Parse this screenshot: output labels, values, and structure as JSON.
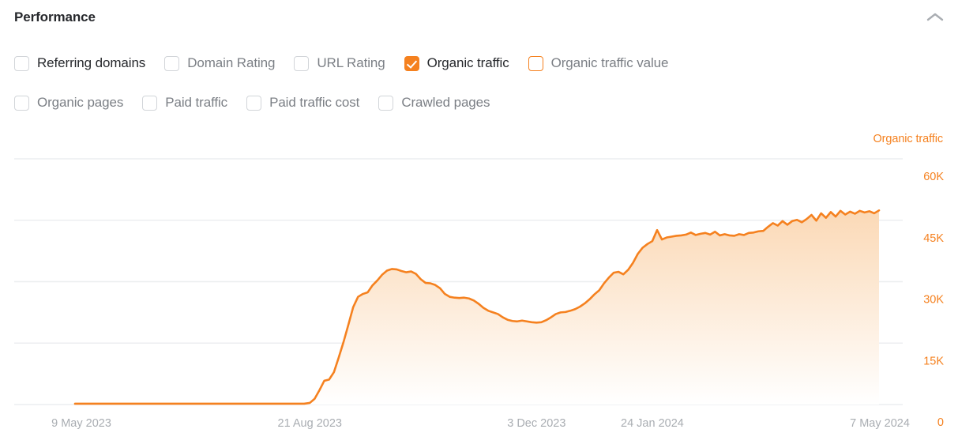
{
  "header": {
    "title": "Performance",
    "collapse_icon": "chevron-up-icon"
  },
  "metrics": {
    "rows": [
      [
        {
          "label": "Referring domains",
          "checked": false,
          "style": "gray"
        },
        {
          "label": "Domain Rating",
          "checked": false,
          "style": "gray"
        },
        {
          "label": "URL Rating",
          "checked": false,
          "style": "gray"
        },
        {
          "label": "Organic traffic",
          "checked": true,
          "style": "orange"
        },
        {
          "label": "Organic traffic value",
          "checked": false,
          "style": "orange-outline"
        }
      ],
      [
        {
          "label": "Organic pages",
          "checked": false,
          "style": "gray"
        },
        {
          "label": "Paid traffic",
          "checked": false,
          "style": "gray"
        },
        {
          "label": "Paid traffic cost",
          "checked": false,
          "style": "gray"
        },
        {
          "label": "Crawled pages",
          "checked": false,
          "style": "gray"
        }
      ]
    ]
  },
  "colors": {
    "accent": "#f5811f",
    "grid": "#eceef0",
    "axis_text": "#a9adb2",
    "title": "#26282c",
    "muted_text": "#7b7f85"
  },
  "chart_data": {
    "type": "area",
    "title": "Organic traffic",
    "series_label": "Organic traffic",
    "xlabel": "",
    "ylabel": "Organic traffic",
    "ylim": [
      0,
      67000
    ],
    "yticks": [
      60000,
      45000,
      30000,
      15000,
      0
    ],
    "ytick_labels": [
      "60K",
      "45K",
      "30K",
      "15K",
      "0"
    ],
    "grid": true,
    "legend_position": "top-right",
    "xtick_labels": [
      "9 May 2023",
      "21 Aug 2023",
      "3 Dec 2023",
      "24 Jan 2024",
      "7 May 2024"
    ],
    "xtick_positions": [
      0.0,
      0.292,
      0.574,
      0.718,
      1.0
    ],
    "x_start": "9 May 2023",
    "x_end": "7 May 2024",
    "line_color": "#f5811f",
    "fill_gradient": [
      "#fbd9b6",
      "#ffffff"
    ],
    "x": [
      0.0,
      0.02,
      0.05,
      0.08,
      0.11,
      0.14,
      0.17,
      0.2,
      0.23,
      0.26,
      0.285,
      0.292,
      0.298,
      0.304,
      0.31,
      0.316,
      0.322,
      0.328,
      0.334,
      0.34,
      0.346,
      0.352,
      0.358,
      0.364,
      0.37,
      0.376,
      0.382,
      0.388,
      0.394,
      0.4,
      0.406,
      0.412,
      0.418,
      0.424,
      0.43,
      0.436,
      0.442,
      0.448,
      0.454,
      0.46,
      0.466,
      0.472,
      0.478,
      0.484,
      0.49,
      0.496,
      0.502,
      0.508,
      0.514,
      0.52,
      0.526,
      0.532,
      0.538,
      0.544,
      0.55,
      0.556,
      0.562,
      0.568,
      0.574,
      0.58,
      0.586,
      0.592,
      0.598,
      0.604,
      0.61,
      0.616,
      0.622,
      0.628,
      0.634,
      0.64,
      0.646,
      0.652,
      0.658,
      0.664,
      0.67,
      0.676,
      0.682,
      0.688,
      0.694,
      0.7,
      0.706,
      0.712,
      0.718,
      0.724,
      0.73,
      0.736,
      0.742,
      0.748,
      0.754,
      0.76,
      0.766,
      0.772,
      0.778,
      0.784,
      0.79,
      0.796,
      0.802,
      0.808,
      0.814,
      0.82,
      0.826,
      0.832,
      0.838,
      0.844,
      0.85,
      0.856,
      0.862,
      0.868,
      0.874,
      0.88,
      0.886,
      0.892,
      0.898,
      0.904,
      0.91,
      0.916,
      0.922,
      0.928,
      0.934,
      0.94,
      0.946,
      0.952,
      0.958,
      0.964,
      0.97,
      0.976,
      0.982,
      0.988,
      0.994,
      1.0
    ],
    "values": [
      200,
      200,
      200,
      200,
      200,
      200,
      200,
      200,
      200,
      200,
      200,
      400,
      1400,
      3500,
      5800,
      6100,
      7900,
      11500,
      15300,
      19500,
      23800,
      26300,
      27000,
      27400,
      29100,
      30300,
      31700,
      32700,
      33100,
      33000,
      32600,
      32300,
      32500,
      31900,
      30600,
      29700,
      29600,
      29200,
      28400,
      27000,
      26300,
      26100,
      26000,
      26100,
      25900,
      25400,
      24600,
      23600,
      22900,
      22500,
      22100,
      21300,
      20700,
      20400,
      20300,
      20500,
      20300,
      20100,
      20000,
      20100,
      20600,
      21300,
      22100,
      22500,
      22600,
      22900,
      23300,
      23900,
      24700,
      25700,
      26900,
      27900,
      29600,
      31000,
      32200,
      32400,
      31800,
      32900,
      34600,
      36800,
      38300,
      39200,
      39900,
      42600,
      40300,
      40800,
      41000,
      41200,
      41300,
      41500,
      42000,
      41400,
      41700,
      41900,
      41500,
      42200,
      41300,
      41600,
      41300,
      41200,
      41600,
      41400,
      41900,
      42000,
      42300,
      42400,
      43400,
      44300,
      43700,
      44800,
      43900,
      44800,
      45100,
      44500,
      45300,
      46300,
      44900,
      46700,
      45600,
      47000,
      45900,
      47300,
      46400,
      47100,
      46600,
      47300,
      46900,
      47200,
      46700,
      47400
    ]
  }
}
